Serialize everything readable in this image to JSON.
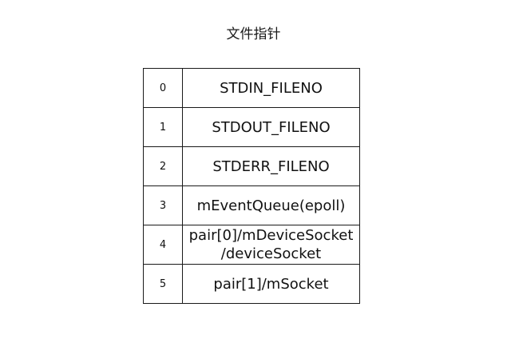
{
  "title": "文件指针",
  "rows": [
    {
      "index": "0",
      "lines": [
        "STDIN_FILENO"
      ]
    },
    {
      "index": "1",
      "lines": [
        "STDOUT_FILENO"
      ]
    },
    {
      "index": "2",
      "lines": [
        "STDERR_FILENO"
      ]
    },
    {
      "index": "3",
      "lines": [
        "mEventQueue(epoll)"
      ]
    },
    {
      "index": "4",
      "lines": [
        "pair[0]/mDeviceSocket",
        "/deviceSocket"
      ]
    },
    {
      "index": "5",
      "lines": [
        "pair[1]/mSocket"
      ]
    }
  ]
}
